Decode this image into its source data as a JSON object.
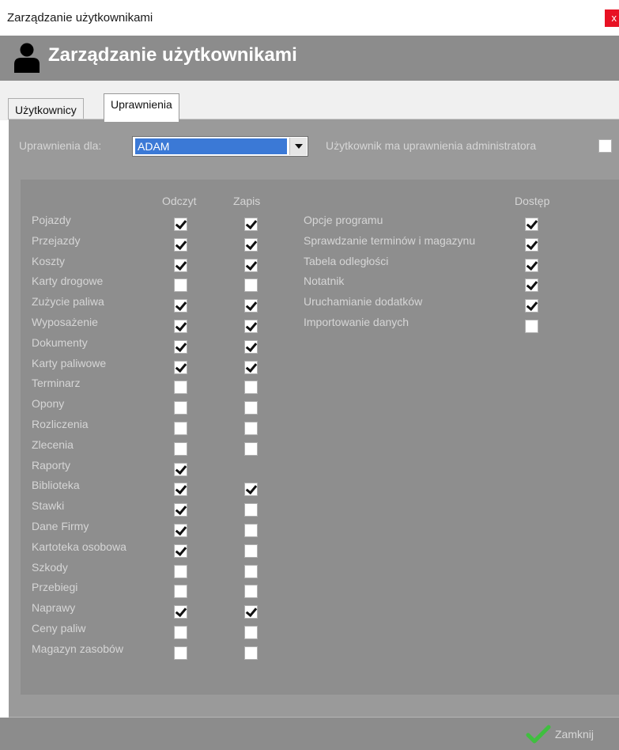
{
  "window": {
    "title": "Zarządzanie użytkownikami",
    "close_glyph": "x"
  },
  "header": {
    "title": "Zarządzanie użytkownikami",
    "icon": "user-icon"
  },
  "tabs": [
    {
      "label": "Użytkownicy",
      "active": false
    },
    {
      "label": "Uprawnienia",
      "active": true
    }
  ],
  "user_select": {
    "label": "Uprawnienia dla:",
    "value": "ADAM"
  },
  "admin": {
    "label": "Użytkownik ma uprawnienia administratora",
    "checked": false
  },
  "columns": {
    "read": "Odczyt",
    "write": "Zapis",
    "access": "Dostęp"
  },
  "modules": [
    {
      "name": "Pojazdy",
      "read": true,
      "write": true
    },
    {
      "name": "Przejazdy",
      "read": true,
      "write": true
    },
    {
      "name": "Koszty",
      "read": true,
      "write": true
    },
    {
      "name": "Karty drogowe",
      "read": false,
      "write": false
    },
    {
      "name": "Zużycie paliwa",
      "read": true,
      "write": true
    },
    {
      "name": "Wyposażenie",
      "read": true,
      "write": true
    },
    {
      "name": "Dokumenty",
      "read": true,
      "write": true
    },
    {
      "name": "Karty paliwowe",
      "read": true,
      "write": true
    },
    {
      "name": "Terminarz",
      "read": false,
      "write": false
    },
    {
      "name": "Opony",
      "read": false,
      "write": false
    },
    {
      "name": "Rozliczenia",
      "read": false,
      "write": false
    },
    {
      "name": "Zlecenia",
      "read": false,
      "write": false
    },
    {
      "name": "Raporty",
      "read": true,
      "write": null
    },
    {
      "name": "Biblioteka",
      "read": true,
      "write": true
    },
    {
      "name": "Stawki",
      "read": true,
      "write": false
    },
    {
      "name": "Dane Firmy",
      "read": true,
      "write": false
    },
    {
      "name": "Kartoteka osobowa",
      "read": true,
      "write": false
    },
    {
      "name": "Szkody",
      "read": false,
      "write": false
    },
    {
      "name": "Przebiegi",
      "read": false,
      "write": false
    },
    {
      "name": "Naprawy",
      "read": true,
      "write": true
    },
    {
      "name": "Ceny paliw",
      "read": false,
      "write": false
    },
    {
      "name": "Magazyn zasobów",
      "read": false,
      "write": false
    }
  ],
  "options": [
    {
      "name": "Opcje programu",
      "access": true
    },
    {
      "name": "Sprawdzanie terminów i magazynu",
      "access": true
    },
    {
      "name": "Tabela odległości",
      "access": true
    },
    {
      "name": "Notatnik",
      "access": true
    },
    {
      "name": "Uruchamianie dodatków",
      "access": true
    },
    {
      "name": "Importowanie danych",
      "access": false
    }
  ],
  "footer": {
    "close_label": "Zamknij",
    "close_icon": "check-icon",
    "accent": "#3fbf3f"
  }
}
